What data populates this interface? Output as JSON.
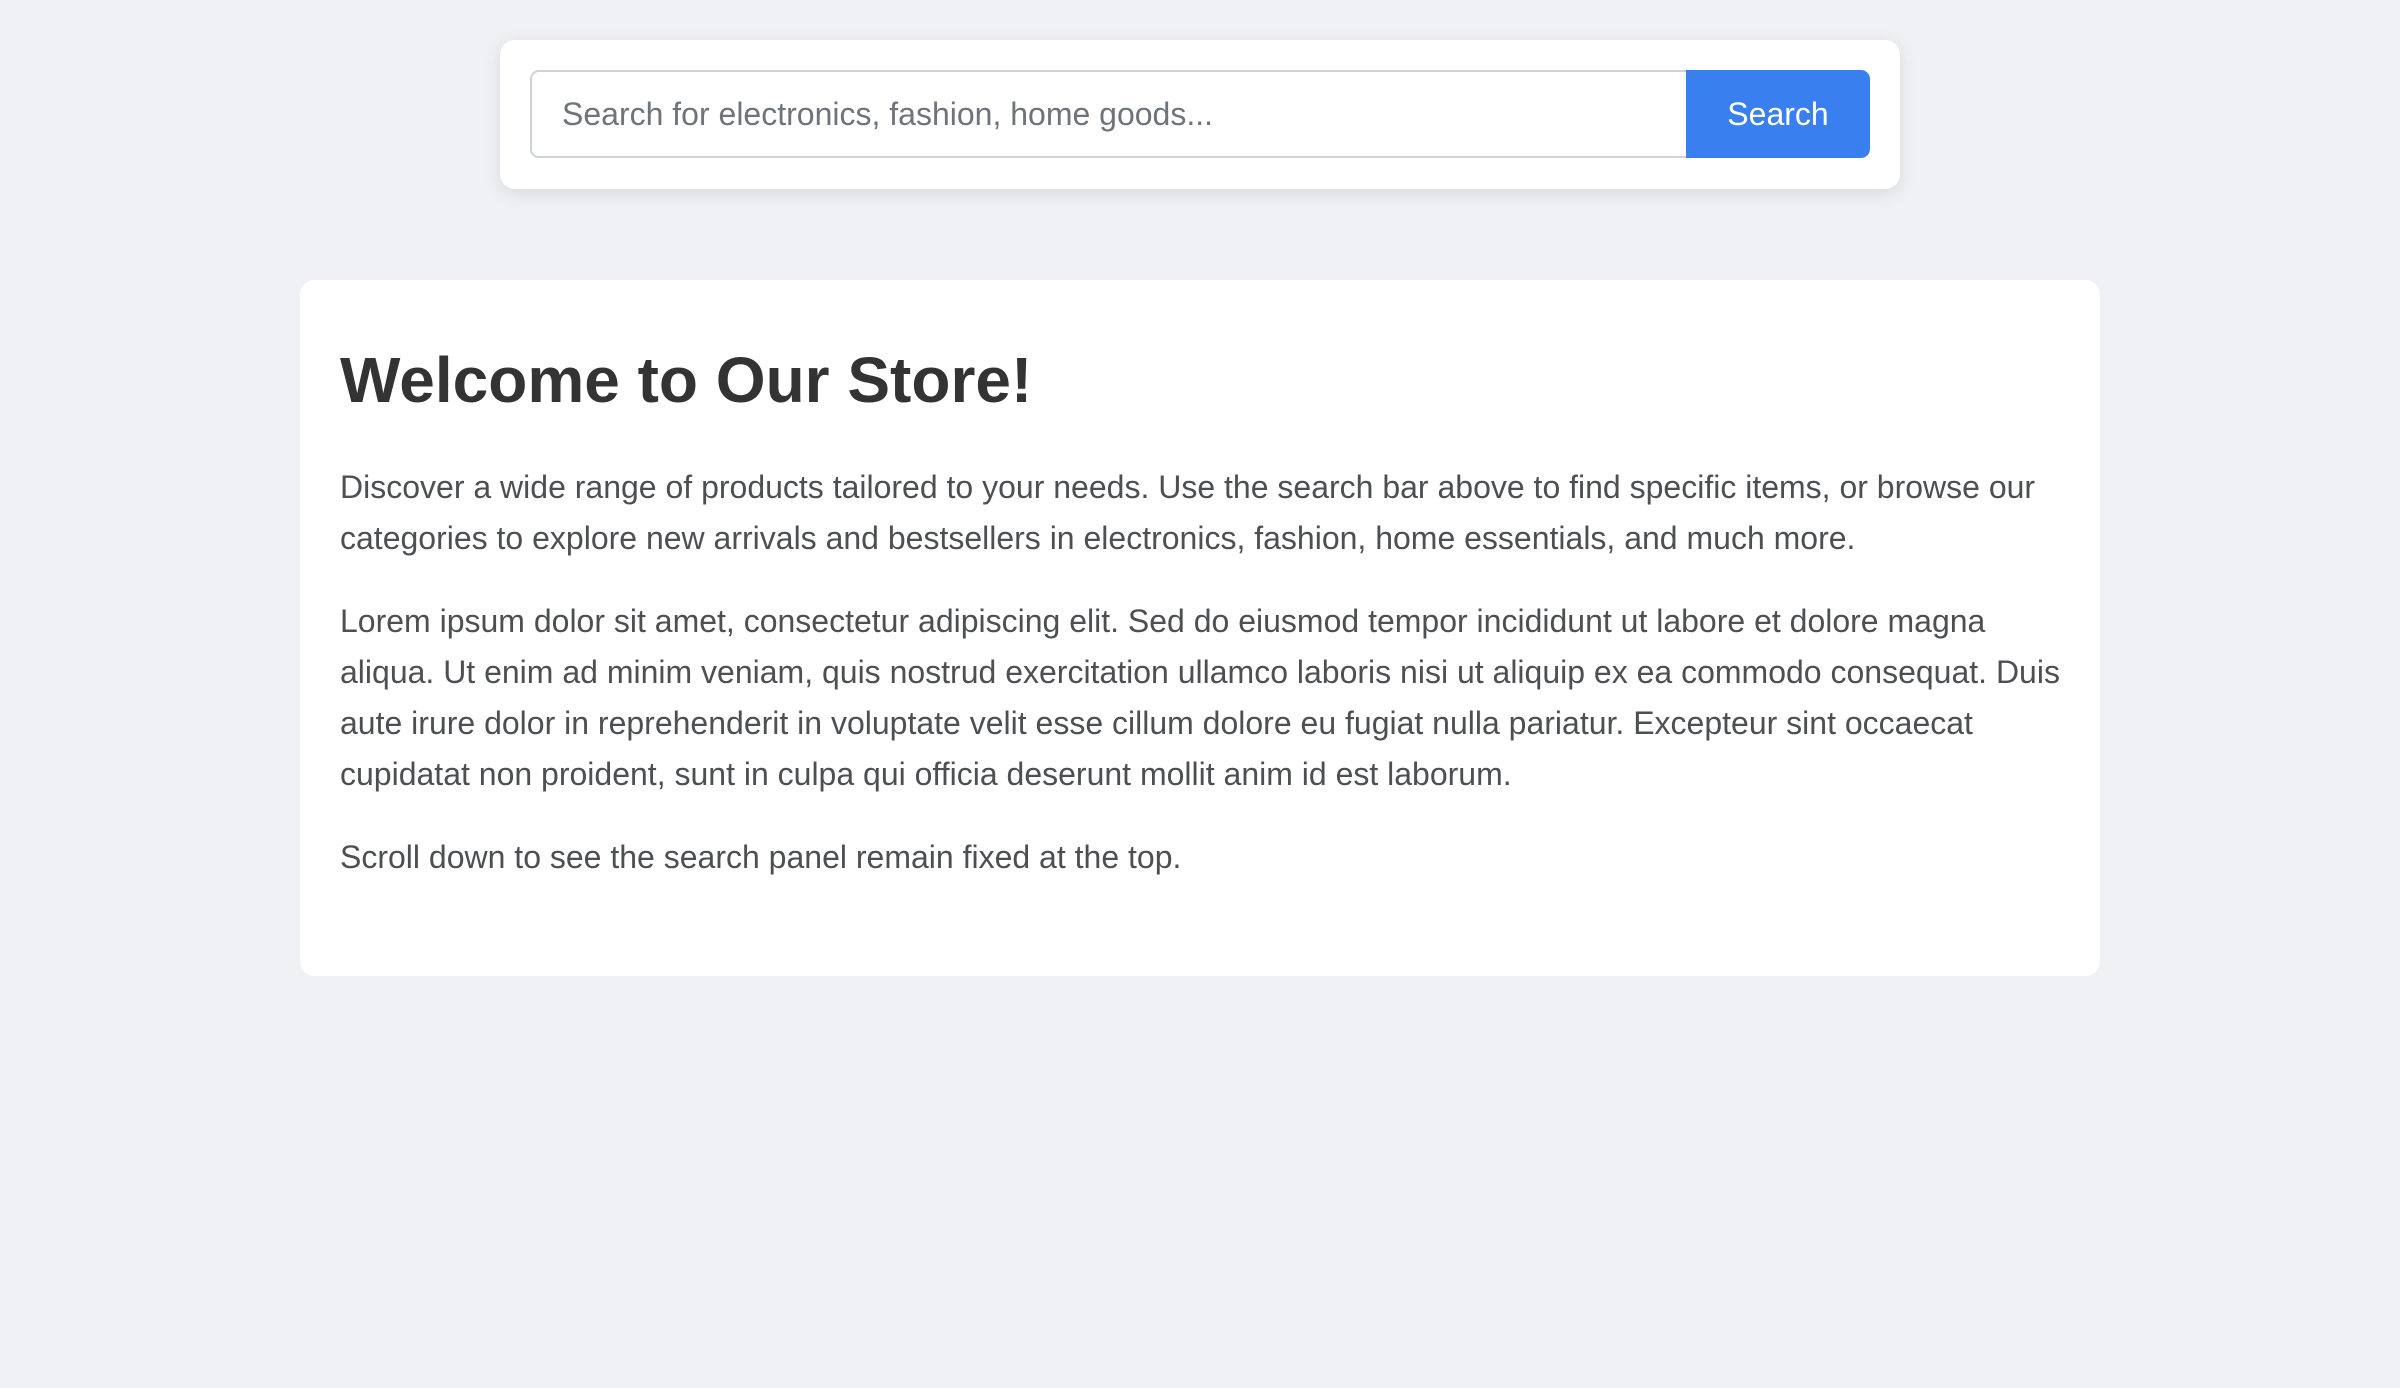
{
  "search": {
    "placeholder": "Search for electronics, fashion, home goods...",
    "button_label": "Search"
  },
  "main": {
    "title": "Welcome to Our Store!",
    "paragraphs": [
      "Discover a wide range of products tailored to your needs. Use the search bar above to find specific items, or browse our categories to explore new arrivals and bestsellers in electronics, fashion, home essentials, and much more.",
      "Lorem ipsum dolor sit amet, consectetur adipiscing elit. Sed do eiusmod tempor incididunt ut labore et dolore magna aliqua. Ut enim ad minim veniam, quis nostrud exercitation ullamco laboris nisi ut aliquip ex ea commodo consequat. Duis aute irure dolor in reprehenderit in voluptate velit esse cillum dolore eu fugiat nulla pariatur. Excepteur sint occaecat cupidatat non proident, sunt in culpa qui officia deserunt mollit anim id est laborum.",
      "Scroll down to see the search panel remain fixed at the top."
    ]
  },
  "colors": {
    "background": "#f0f1f5",
    "accent": "#3a7ff0",
    "heading": "#333333",
    "body_text": "#4d4f53"
  }
}
